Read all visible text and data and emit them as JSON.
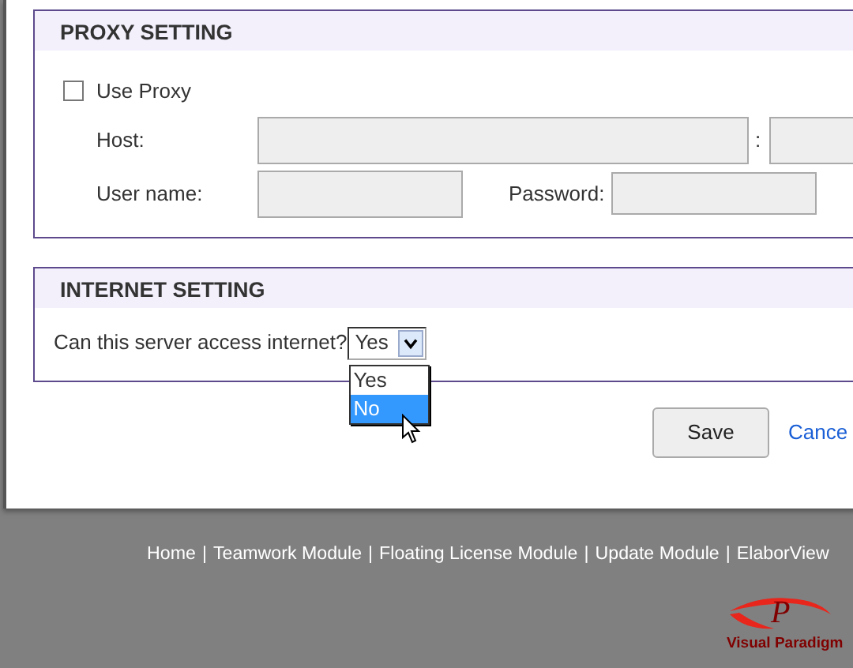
{
  "proxy_setting": {
    "title": "PROXY SETTING",
    "use_proxy": {
      "label": "Use Proxy",
      "checked": false
    },
    "fields": [
      {
        "kind": "host",
        "label": "Host:",
        "separator": ":",
        "disabled": true
      },
      {
        "kind": "user",
        "label": "User name:",
        "disabled": true
      },
      {
        "kind": "password",
        "label": "Password:",
        "disabled": true
      }
    ]
  },
  "internet_setting": {
    "title": "INTERNET SETTING",
    "question": "Can this server access internet?",
    "select": {
      "value": "Yes",
      "expanded": true,
      "options": [
        {
          "label": "Yes",
          "highlighted": false
        },
        {
          "label": "No",
          "highlighted": true
        }
      ]
    }
  },
  "buttons": [
    {
      "kind": "button",
      "label": "Save"
    },
    {
      "kind": "link",
      "label": "Cance"
    }
  ],
  "footer": [
    {
      "kind": "link",
      "label": "Home"
    },
    {
      "kind": "separator",
      "label": "|"
    },
    {
      "kind": "link",
      "label": "Teamwork Module"
    },
    {
      "kind": "separator",
      "label": "|"
    },
    {
      "kind": "link",
      "label": "Floating License Module"
    },
    {
      "kind": "separator",
      "label": "|"
    },
    {
      "kind": "link",
      "label": "Update Module"
    },
    {
      "kind": "separator",
      "label": "|"
    },
    {
      "kind": "link",
      "label": "ElaborView"
    }
  ],
  "logo": {
    "mark": "P",
    "name": "Visual Paradigm"
  }
}
